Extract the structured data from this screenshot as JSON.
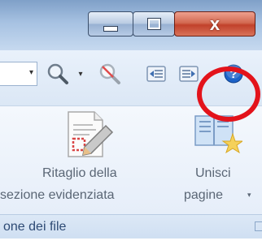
{
  "window": {
    "minimize_icon": "minimize-icon",
    "maximize_icon": "maximize-icon",
    "close_label": "x"
  },
  "toolbar": {
    "dropdown_arrow": "▾",
    "zoom_dropdown_arrow": "▾",
    "icons": [
      "zoom-in-icon",
      "zoom-out-icon",
      "previous-page-icon",
      "next-page-icon",
      "help-icon"
    ]
  },
  "ribbon": {
    "ritaglio_line1": "Ritaglio della",
    "ritaglio_line2": "sezione evidenziata",
    "unisci_line1": "Unisci",
    "unisci_line2": "pagine",
    "unisci_dropdown": "▾",
    "group_label": "one dei file"
  },
  "colors": {
    "annotation": "#e3131b",
    "help_blue": "#1d63c8",
    "close_red": "#c1412b"
  }
}
